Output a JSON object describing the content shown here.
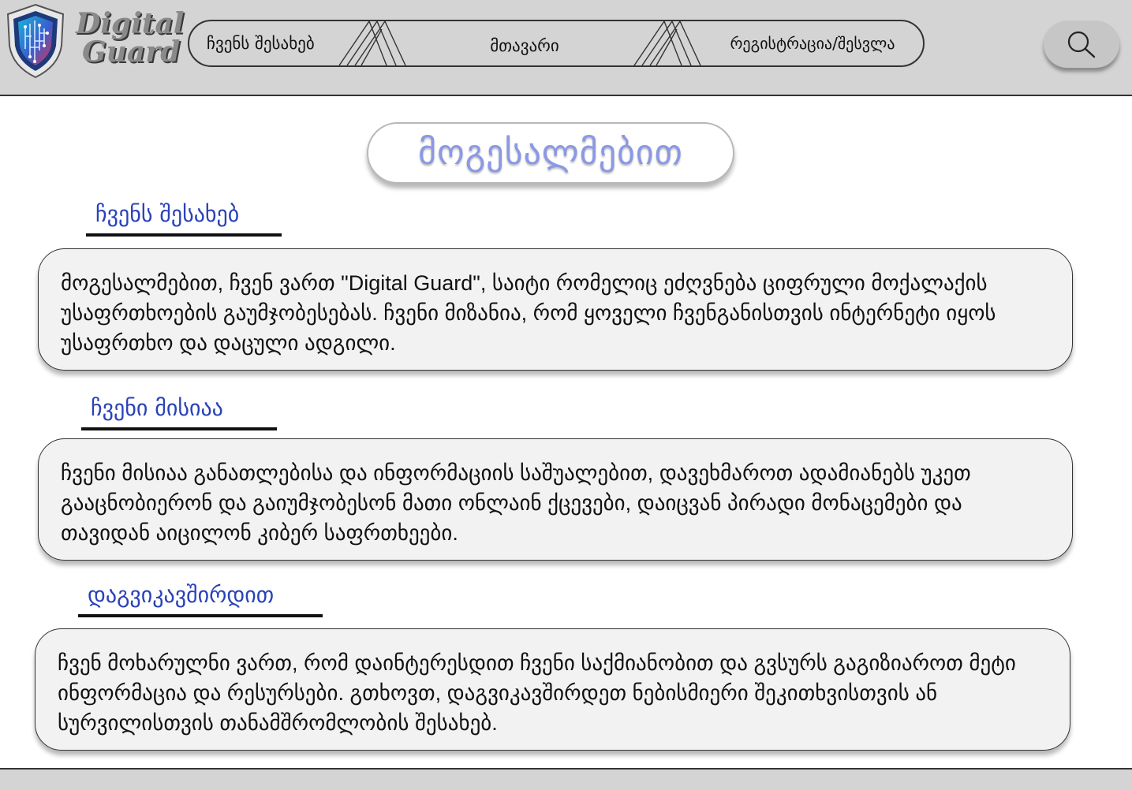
{
  "header": {
    "logo": {
      "line1": "Digital",
      "line2": "Guard"
    },
    "nav": {
      "about": "ჩვენს შესახებ",
      "home": "მთავარი",
      "register": "რეგისტრაცია/შესვლა"
    },
    "search_icon": "search-icon"
  },
  "main": {
    "welcome": "მოგესალმებით",
    "sections": [
      {
        "title": "ჩვენს შესახებ",
        "text": "მოგესალმებით, ჩვენ ვართ \"Digital Guard\", საიტი რომელიც ეძღვნება ციფრული მოქალაქის უსაფრთხოების გაუმჯობესებას. ჩვენი მიზანია, რომ ყოველი ჩვენგანისთვის ინტერნეტი იყოს უსაფრთხო და დაცული ადგილი."
      },
      {
        "title": "ჩვენი მისიაა",
        "text": "ჩვენი მისიაა განათლებისა და ინფორმაციის საშუალებით, დავეხმაროთ ადამიანებს უკეთ გააცნობიერონ და გაიუმჯობესონ მათი ონლაინ ქცევები, დაიცვან პირადი მონაცემები და თავიდან აიცილონ კიბერ საფრთხეები."
      },
      {
        "title": "დაგვიკავშირდით",
        "text": "ჩვენ მოხარულნი ვართ, რომ დაინტერესდით ჩვენი საქმიანობით და გვსურს გაგიზიაროთ მეტი ინფორმაცია და რესურსები. გთხოვთ, დაგვიკავშირდეთ ნებისმიერი შეკითხვისთვის ან სურვილისთვის თანამშრომლობის შესახებ."
      }
    ]
  },
  "colors": {
    "header_bg": "#d4d4d4",
    "welcome_text": "#8b98e6",
    "section_title": "#2a42b8",
    "card_bg": "#f2f2f2"
  }
}
